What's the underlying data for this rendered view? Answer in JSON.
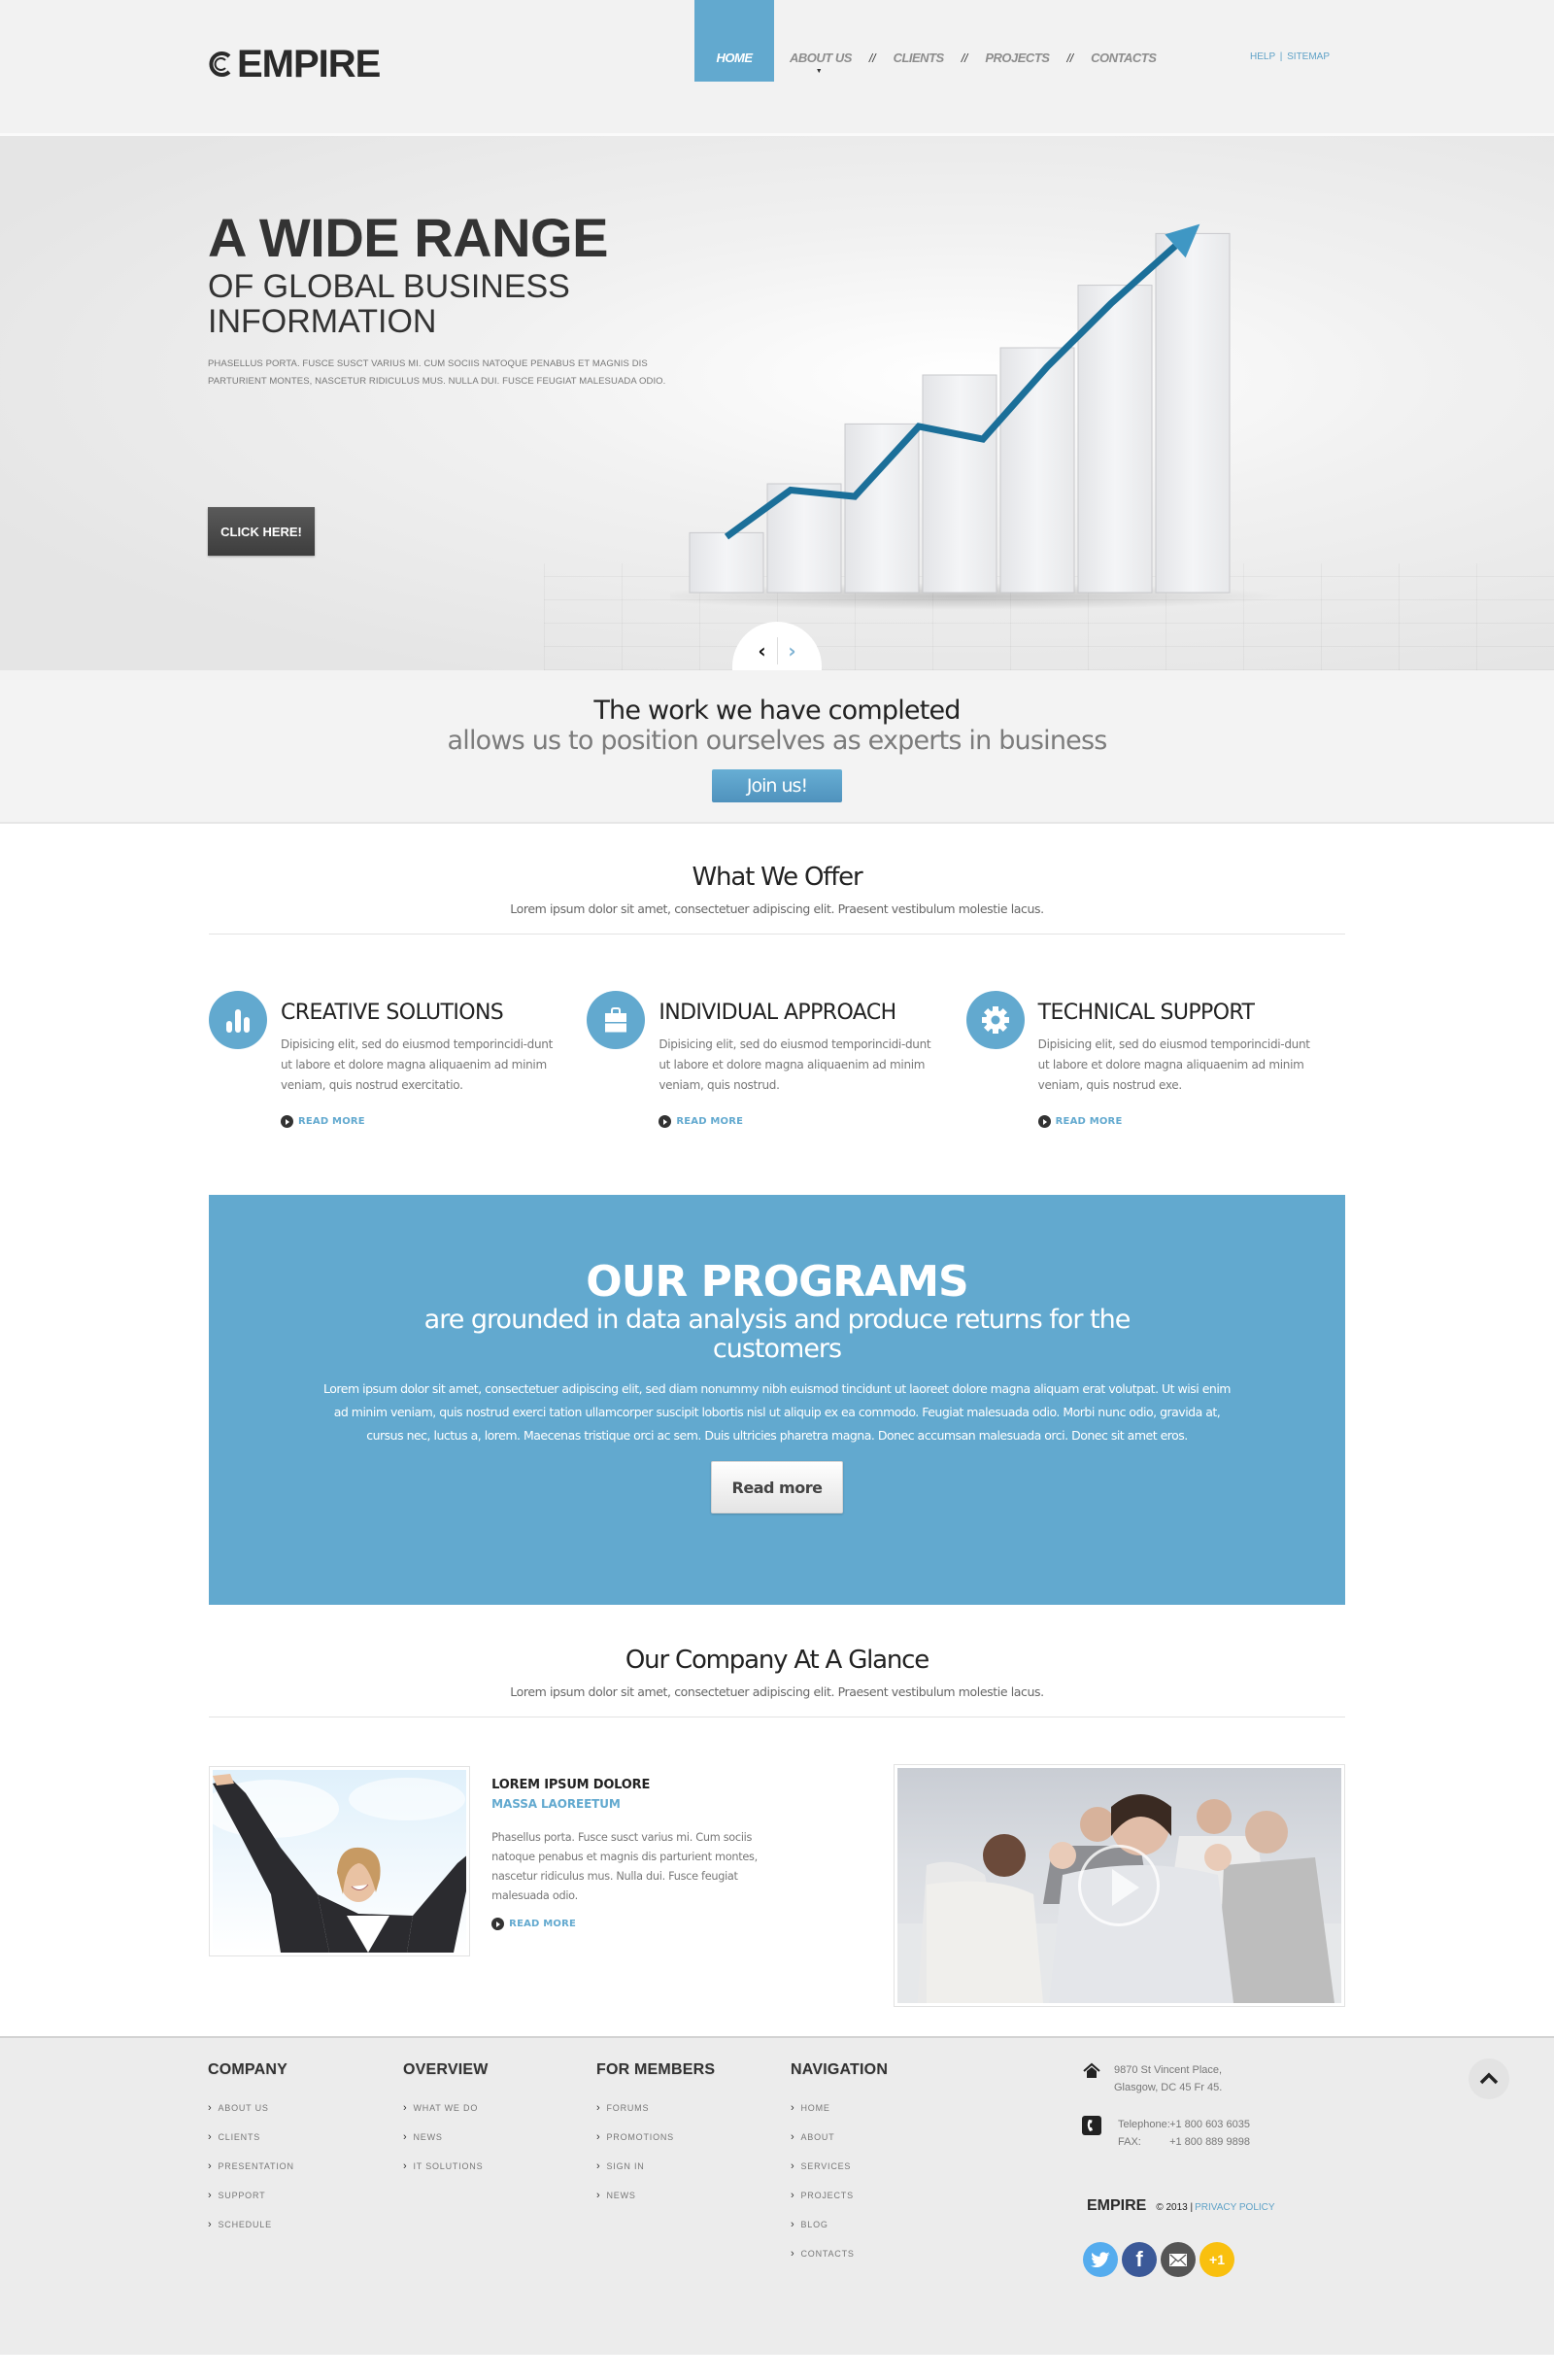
{
  "header": {
    "logo_text": "EMPIRE",
    "nav": [
      {
        "label": "HOME",
        "active": true
      },
      {
        "label": "ABOUT US",
        "has_dropdown": true
      },
      {
        "label": "CLIENTS"
      },
      {
        "label": "PROJECTS"
      },
      {
        "label": "CONTACTS"
      }
    ],
    "nav_separator": "//",
    "utility_links": {
      "help": "HELP",
      "separator": "|",
      "sitemap": "SITEMAP"
    }
  },
  "hero": {
    "title": "A WIDE RANGE",
    "subtitle_line1": "OF GLOBAL BUSINESS",
    "subtitle_line2": "INFORMATION",
    "text": "PHASELLUS PORTA. FUSCE SUSCT VARIUS MI. CUM SOCIIS NATOQUE PENABUS ET MAGNIS DIS PARTURIENT MONTES, NASCETUR RIDICULUS MUS. NULLA DUI. FUSCE FEUGIAT MALESUADA ODIO.",
    "button_label": "CLICK HERE!",
    "slider_prev": "‹",
    "slider_next": "›",
    "illustration": {
      "description": "3D rising bar chart with upward trend arrow",
      "bar_heights_relative": [
        0.22,
        0.4,
        0.62,
        0.8,
        0.9,
        1.13,
        1.32
      ],
      "trend_line_relative": [
        0.08,
        0.3,
        0.27,
        0.6,
        0.54,
        0.88,
        1.18,
        1.45
      ],
      "accent_color": "#1b6f99"
    }
  },
  "banner": {
    "line1": "The work we have completed",
    "line2": "allows us to position ourselves as experts in business",
    "button_label": "Join us!"
  },
  "offer": {
    "title": "What We Offer",
    "subtitle": "Lorem ipsum dolor sit amet, consectetuer adipiscing elit. Praesent vestibulum molestie lacus.",
    "features": [
      {
        "icon": "bar-chart-icon",
        "title": "CREATIVE SOLUTIONS",
        "text": "Dipisicing elit, sed do eiusmod temporincidi-dunt ut labore et dolore magna aliquaenim ad minim veniam, quis nostrud exercitatio.",
        "link": "READ MORE"
      },
      {
        "icon": "briefcase-icon",
        "title": "INDIVIDUAL APPROACH",
        "text": "Dipisicing elit, sed do eiusmod temporincidi-dunt ut labore et dolore magna aliquaenim ad minim veniam, quis nostrud.",
        "link": "READ MORE"
      },
      {
        "icon": "gear-icon",
        "title": "TECHNICAL SUPPORT",
        "text": "Dipisicing elit, sed do eiusmod temporincidi-dunt ut labore et dolore magna aliquaenim ad minim veniam, quis nostrud exe.",
        "link": "READ MORE"
      }
    ]
  },
  "programs": {
    "title": "OUR PROGRAMS",
    "subtitle": "are grounded in data analysis and produce returns for the customers",
    "text": "Lorem ipsum dolor sit amet, consectetuer adipiscing elit, sed diam nonummy nibh euismod tincidunt ut laoreet dolore magna aliquam erat volutpat. Ut wisi enim ad minim veniam, quis nostrud exerci tation ullamcorper suscipit lobortis nisl ut aliquip ex ea commodo. Feugiat malesuada odio. Morbi nunc odio, gravida at, cursus nec, luctus a, lorem. Maecenas tristique orci ac sem. Duis ultricies pharetra magna. Donec accumsan malesuada orci. Donec sit amet eros.",
    "button_label": "Read more",
    "bg_color": "#62a9cf"
  },
  "glance": {
    "title": "Our Company At A Glance",
    "subtitle": "Lorem ipsum dolor sit amet, consectetuer adipiscing elit. Praesent vestibulum molestie lacus.",
    "article": {
      "heading": "LOREM IPSUM DOLORE",
      "subheading": "MASSA LAOREETUM",
      "text": "Phasellus porta. Fusce susct varius mi. Cum sociis natoque penabus et magnis dis parturient montes, nascetur ridiculus mus. Nulla dui. Fusce feugiat malesuada odio.",
      "link": "READ MORE",
      "image_alt": "Businesswoman raising arms against sky"
    },
    "video_alt": "Cheering business team around table"
  },
  "footer": {
    "columns": [
      {
        "title": "COMPANY",
        "items": [
          "ABOUT US",
          "CLIENTS",
          "PRESENTATION",
          "SUPPORT",
          "SCHEDULE"
        ]
      },
      {
        "title": "OVERVIEW",
        "items": [
          "WHAT WE DO",
          "NEWS",
          "IT SOLUTIONS"
        ]
      },
      {
        "title": "FOR MEMBERS",
        "items": [
          "FORUMS",
          "PROMOTIONS",
          "SIGN IN",
          "NEWS"
        ]
      },
      {
        "title": "NAVIGATION",
        "items": [
          "HOME",
          "ABOUT",
          "SERVICES",
          "PROJECTS",
          "BLOG",
          "CONTACTS"
        ]
      }
    ],
    "address_line1": "9870 St Vincent Place,",
    "address_line2": "Glasgow, DC 45 Fr 45.",
    "telephone_label": "Telephone:",
    "telephone": "+1 800 603 6035",
    "fax_label": "FAX:",
    "fax": "+1 800 889 9898",
    "brand": "EMPIRE",
    "copyright": "© 2013 |",
    "privacy": "PRIVACY POLICY",
    "social": [
      {
        "name": "twitter",
        "label": "",
        "color": "#55acee"
      },
      {
        "name": "facebook",
        "label": "f",
        "color": "#3b5998"
      },
      {
        "name": "email",
        "label": "",
        "color": "#555555"
      },
      {
        "name": "google-plus-one",
        "label": "+1",
        "color": "#f9c00f"
      }
    ]
  }
}
